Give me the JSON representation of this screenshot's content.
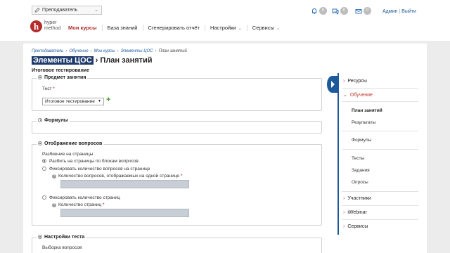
{
  "header": {
    "role_selector": "Преподаватель",
    "notifications": [
      {
        "icon": "bell-icon",
        "count": "0"
      },
      {
        "icon": "chat-icon",
        "count": "0"
      },
      {
        "icon": "mail-icon",
        "count": "0"
      }
    ],
    "user": {
      "name": "Админ",
      "logout": "Выйти",
      "separator": "|"
    },
    "logo": {
      "letter": "h",
      "line1": "hyper",
      "line2": "method"
    },
    "nav": [
      {
        "label": "Мои курсы"
      },
      {
        "label": "База знаний"
      },
      {
        "label": "Сгенерировать отчёт"
      },
      {
        "label": "Настройки",
        "caret": "⌄"
      },
      {
        "label": "Сервисы",
        "caret": "⌄"
      }
    ]
  },
  "breadcrumb": {
    "items": [
      "Преподаватель",
      "Обучение",
      "Мои курсы",
      "Элементы ЦОС",
      "План занятий"
    ],
    "separator": "›"
  },
  "page": {
    "title_highlight": "Элементы ЦОС",
    "title_rest": " › План занятий",
    "subtitle": "Итоговое тестирование"
  },
  "form": {
    "subject": {
      "legend": "Предмет занятия",
      "test_label": "Тест",
      "required_mark": "*",
      "test_value": "Итоговое тестирование",
      "add": "+"
    },
    "formulas": {
      "legend": "Формулы"
    },
    "questions_display": {
      "legend": "Отображение вопросов",
      "pagination_label": "Разбиение на страницы",
      "option1": "Разбить на страницы по блокам вопросов",
      "option2": "Фиксировать количество вопросов на странице",
      "option2_field": "Количество вопросов, отображаемых на одной странице",
      "option3": "Фиксировать количество страниц",
      "option3_field": "Количество страниц",
      "required_mark": "*",
      "help": "?"
    },
    "test_settings": {
      "legend": "Настройки теста",
      "selection_label": "Выборка вопросов"
    }
  },
  "sidebar": {
    "sections": [
      {
        "label": "Ресурсы",
        "expanded": false
      },
      {
        "label": "Обучение",
        "expanded": true,
        "items": [
          "План занятий",
          "Результаты",
          "Формулы",
          "Тесты",
          "Задания",
          "Опросы"
        ]
      },
      {
        "label": "Участники",
        "expanded": false
      },
      {
        "label": "iWebinar",
        "expanded": false
      },
      {
        "label": "Сервисы",
        "expanded": false
      }
    ]
  },
  "colors": {
    "accent_red": "#b52a2a",
    "link_blue": "#1c5a9c",
    "title_highlight_bg": "#1f3b6b",
    "add_green": "#3b9a1f"
  }
}
